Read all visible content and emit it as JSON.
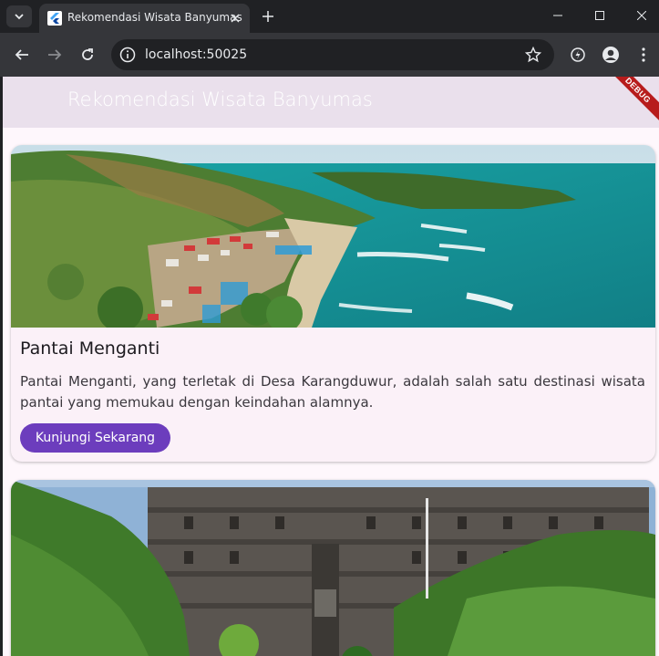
{
  "browser": {
    "tab_title": "Rekomendasi Wisata Banyumas",
    "url": "localhost:50025"
  },
  "app": {
    "title": "Rekomendasi Wisata Banyumas",
    "debug_label": "DEBUG"
  },
  "cards": [
    {
      "title": "Pantai Menganti",
      "description": "Pantai Menganti, yang terletak di Desa Karangduwur, adalah salah satu destinasi wisata pantai yang memukau dengan keindahan alamnya.",
      "button_label": "Kunjungi Sekarang"
    }
  ],
  "colors": {
    "appbar": "#eae0ec",
    "page_bg": "#fef7fc",
    "button": "#6c3dbd",
    "debug": "#b71c1c"
  }
}
